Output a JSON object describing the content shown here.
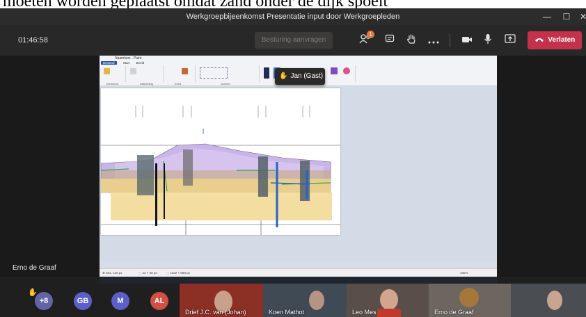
{
  "caption": "moeten worden geplaatst omdat zand onder de dijk spoelt",
  "window": {
    "title": "Werkgroepbijeenkomst Presentatie input door Werkgroepleden",
    "minimize_glyph": "—",
    "maximize_glyph": "☐",
    "close_glyph": "✕"
  },
  "controls": {
    "timer": "01:46:58",
    "request_control_label": "Besturing aanvragen",
    "participants_badge": "1",
    "leave_label": "Verlaten",
    "icons": [
      "participants-icon",
      "chat-icon",
      "raise-hand-icon",
      "more-icon",
      "camera-icon",
      "microphone-icon",
      "share-icon",
      "phone-icon"
    ],
    "leave_color": "#c4314b"
  },
  "shared_screen": {
    "paint_title": "Naamloos - Paint",
    "paint_tabs": [
      "Bestand",
      "Start",
      "Beeld"
    ],
    "ribbon_groups": [
      "Klembord",
      "Afbeelding",
      "Extra",
      "Vormen",
      "Kleuren"
    ],
    "status_items": [
      "⊕ 361, 415 px",
      "⬚ 23 × 20 px",
      "⬚ 1152 × 688 px",
      "100%"
    ],
    "raise_hand_popup": "Jan (Gast)"
  },
  "presenter_name": "Erno de Graaf",
  "participants": {
    "avatars": [
      {
        "initials": "+8",
        "color": "#6264a7"
      },
      {
        "initials": "GB",
        "color": "#5b5fc7"
      },
      {
        "initials": "M",
        "color": "#5b5fc7"
      },
      {
        "initials": "AL",
        "color": "#d14f43"
      }
    ],
    "video_tiles": [
      {
        "name": "Drief J.C. van (Johan)",
        "bg": "#8c2f24"
      },
      {
        "name": "Koen Mathot",
        "bg": "#3f4a55"
      },
      {
        "name": "Leo Mes",
        "bg": "#5a4f48"
      },
      {
        "name": "Erno de Graaf",
        "bg": "#6d6660"
      },
      {
        "name": "",
        "bg": "#4a4e52"
      }
    ]
  }
}
